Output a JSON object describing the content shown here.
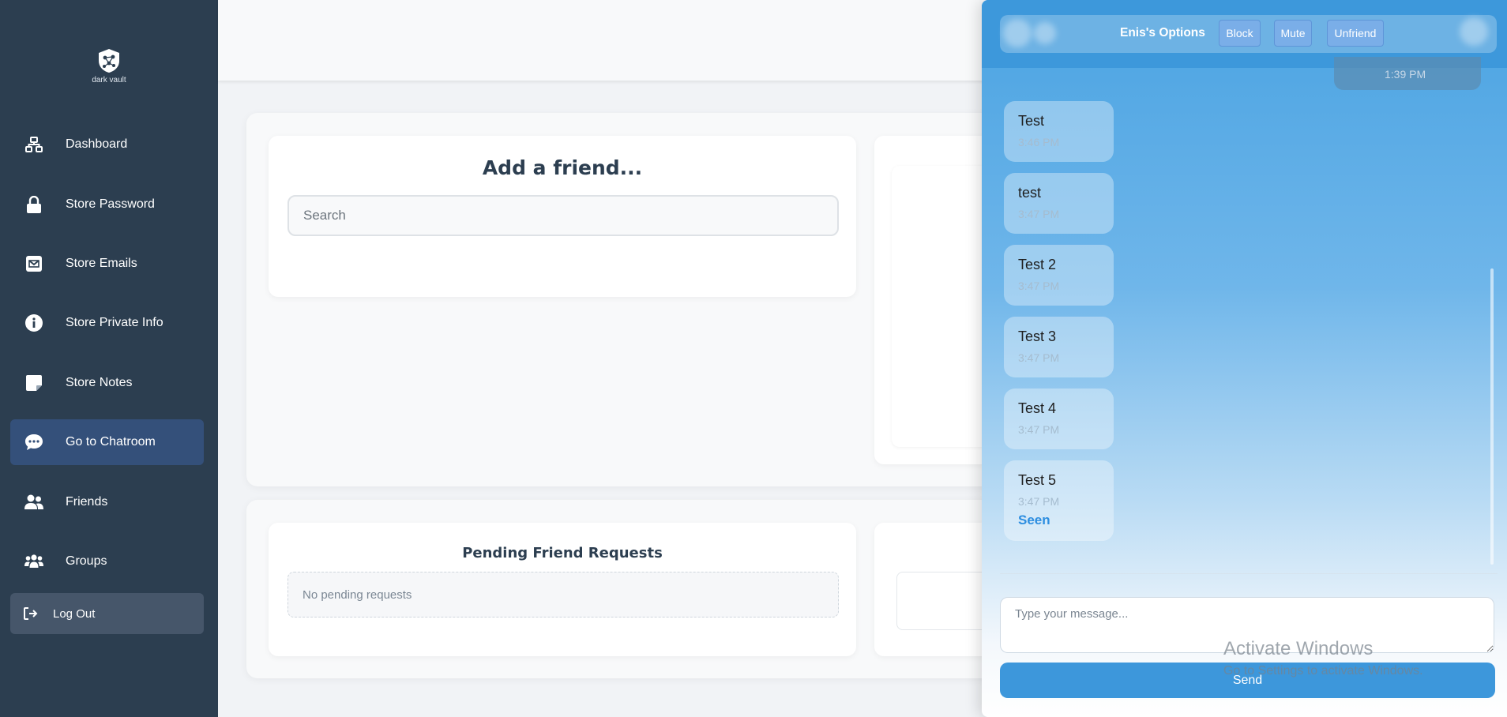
{
  "sidebar": {
    "logo_text": "dark vault",
    "items": [
      {
        "label": "Dashboard",
        "icon": "sitemap-icon"
      },
      {
        "label": "Store Password",
        "icon": "lock-icon"
      },
      {
        "label": "Store Emails",
        "icon": "envelope-icon"
      },
      {
        "label": "Store Private Info",
        "icon": "info-circle-icon"
      },
      {
        "label": "Store Notes",
        "icon": "sticky-note-icon"
      },
      {
        "label": "Go to Chatroom",
        "icon": "chat-bubble-icon",
        "active": true
      },
      {
        "label": "Friends",
        "icon": "user-friends-icon"
      },
      {
        "label": "Groups",
        "icon": "users-icon"
      }
    ],
    "logout_label": "Log Out"
  },
  "main": {
    "add_friend_title": "Add a friend...",
    "search_placeholder": "Search",
    "pending_title": "Pending Friend Requests",
    "pending_empty": "No pending requests"
  },
  "chat": {
    "options_title": "Enis's Options",
    "block_label": "Block",
    "mute_label": "Mute",
    "unfriend_label": "Unfriend",
    "partial_time": "1:39 PM",
    "messages": [
      {
        "text": "Test",
        "time": "3:46 PM"
      },
      {
        "text": "test",
        "time": "3:47 PM"
      },
      {
        "text": "Test 2",
        "time": "3:47 PM"
      },
      {
        "text": "Test 3",
        "time": "3:47 PM"
      },
      {
        "text": "Test 4",
        "time": "3:47 PM"
      },
      {
        "text": "Test 5",
        "time": "3:47 PM",
        "status": "Seen"
      }
    ],
    "input_placeholder": "Type your message...",
    "send_label": "Send"
  },
  "overlay": {
    "activate_title": "Activate Windows",
    "activate_sub": "Go to Settings to activate Windows."
  },
  "colors": {
    "sidebar_bg": "#2c3e50",
    "active_item": "#34507a",
    "chat_accent": "#3d97db",
    "seen": "#2d8ee0"
  }
}
